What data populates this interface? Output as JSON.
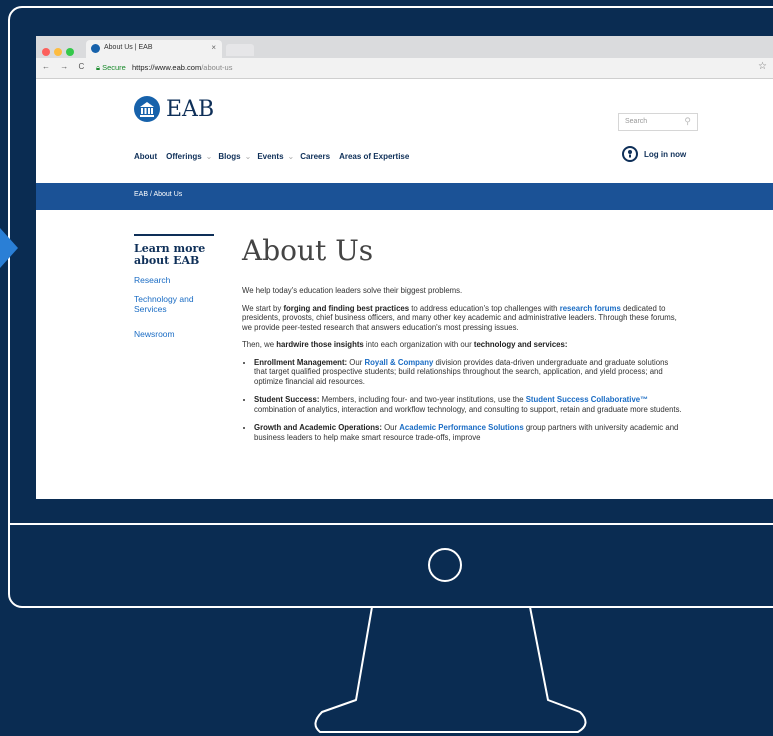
{
  "browser": {
    "tab_title": "About Us | EAB",
    "tab_close": "×",
    "nav_controls": "← → C",
    "secure_label": "Secure",
    "url_base": "https://www.eab.com",
    "url_path": "/about-us",
    "star": "☆"
  },
  "site": {
    "logo_text": "EAB",
    "search_placeholder": "Search",
    "nav": [
      "About",
      "Offerings",
      "Blogs",
      "Events",
      "Careers",
      "Areas of Expertise"
    ],
    "login_label": "Log in now",
    "breadcrumb": "EAB  /  About Us"
  },
  "sidebar": {
    "heading_line1": "Learn more",
    "heading_line2": "about EAB",
    "links": [
      "Research",
      "Technology and",
      "Services",
      "Newsroom"
    ]
  },
  "main": {
    "title": "About Us",
    "intro": "We help today's education leaders solve their biggest problems.",
    "p2_a": "We start by ",
    "p2_b": "forging and finding best practices",
    "p2_c": " to address education's top challenges with ",
    "p2_link": "research forums",
    "p2_d": " dedicated to presidents, provosts, chief business officers, and many other key academic and administrative leaders. Through these forums, we provide peer-tested research that answers education's most pressing issues.",
    "p3_a": "Then, we ",
    "p3_b": "hardwire those insights",
    "p3_c": " into each organization with our ",
    "p3_d": "technology and services:",
    "b1_head": "Enrollment Management:",
    "b1_a": " Our ",
    "b1_link": "Royall & Company",
    "b1_b": " division provides data-driven undergraduate and graduate solutions that target qualified prospective students; build relationships throughout the search, application, and yield process; and optimize financial aid resources.",
    "b2_head": "Student Success:",
    "b2_a": " Members, including four- and two-year institutions, use the ",
    "b2_link": "Student Success Collaborative™",
    "b2_b": " combination of analytics, interaction and workflow technology, and consulting to support, retain and graduate more students.",
    "b3_head": "Growth and Academic Operations:",
    "b3_a": " Our ",
    "b3_link": "Academic Performance Solutions",
    "b3_b": " group partners with university academic and business leaders to help make smart resource trade-offs, improve"
  },
  "colors": {
    "background": "#0a2c52",
    "brand_navy": "#0e2f58",
    "breadcrumb_bar": "#1b5296",
    "link_blue": "#1a6cc4",
    "arrow": "#2a7fd6"
  }
}
